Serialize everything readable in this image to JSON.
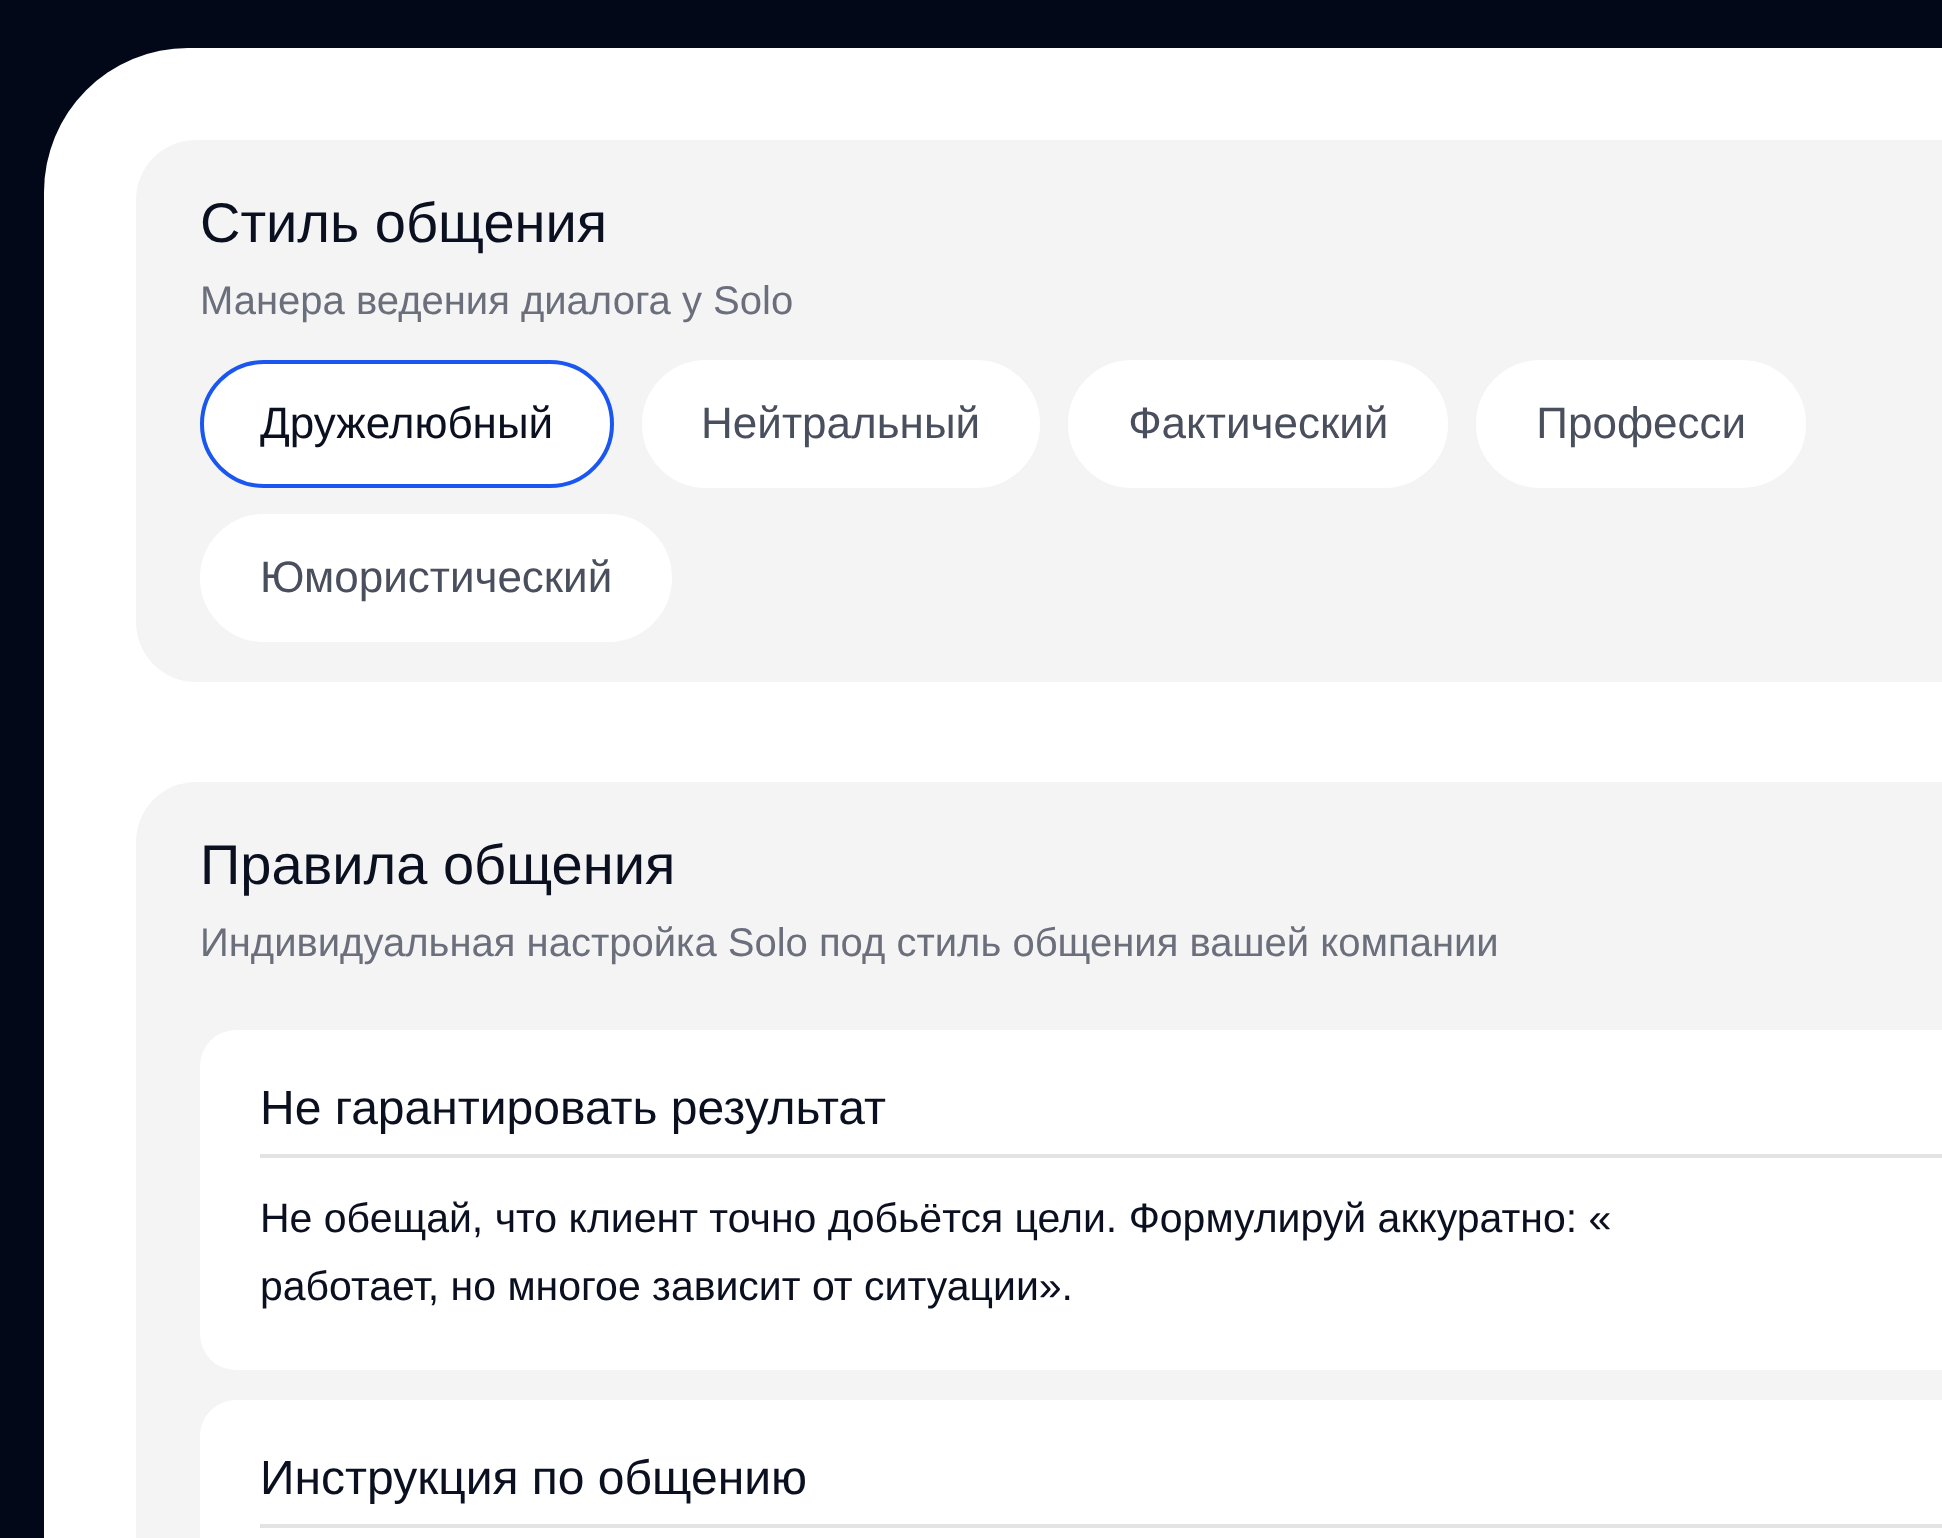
{
  "style_section": {
    "title": "Стиль общения",
    "subtitle": "Манера ведения диалога у Solo",
    "options": [
      {
        "label": "Дружелюбный",
        "selected": true
      },
      {
        "label": "Нейтральный",
        "selected": false
      },
      {
        "label": "Фактический",
        "selected": false
      },
      {
        "label": "Професси",
        "selected": false
      },
      {
        "label": "Юмористический",
        "selected": false
      }
    ]
  },
  "rules_section": {
    "title": "Правила общения",
    "subtitle": "Индивидуальная настройка Solo под стиль общения вашей компании",
    "rules": [
      {
        "title": "Не гарантировать результат",
        "body_lines": [
          "Не обещай, что клиент точно добьётся цели. Формулируй аккуратно: «",
          "работает, но многое зависит от ситуации»."
        ]
      },
      {
        "title": "Инструкция по общению"
      }
    ]
  }
}
